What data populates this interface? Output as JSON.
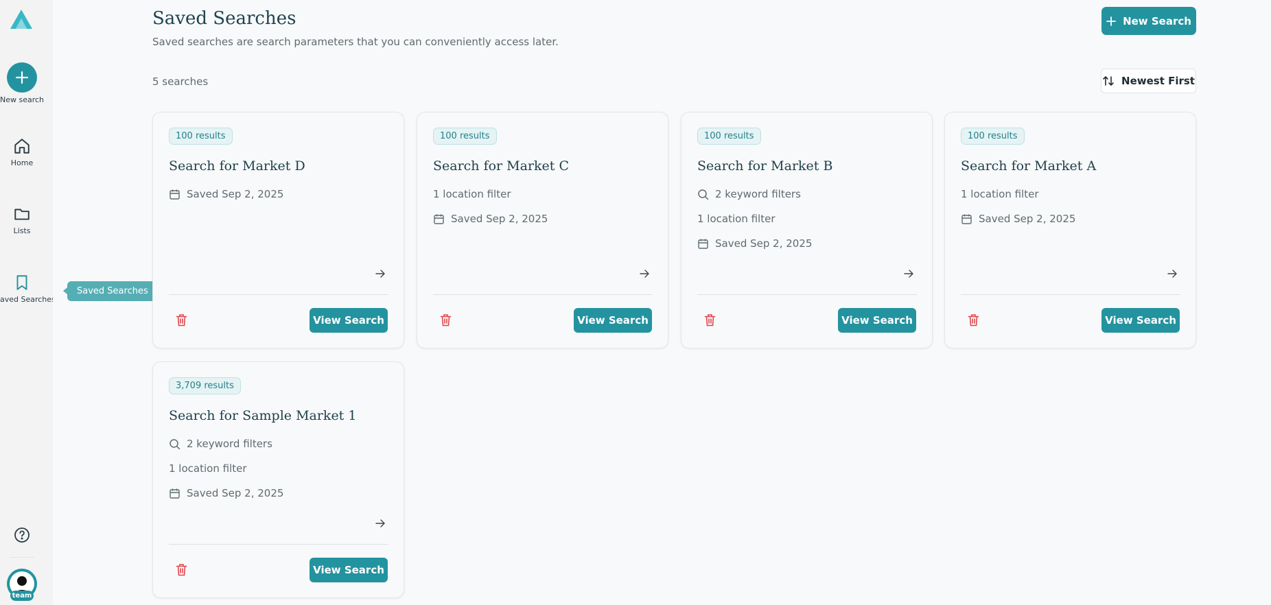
{
  "sidebar": {
    "new_search_label": "New search",
    "items": [
      {
        "label": "Home",
        "icon": "home-icon"
      },
      {
        "label": "Lists",
        "icon": "folder-icon"
      },
      {
        "label": "Saved Searches",
        "icon": "bookmark-icon"
      }
    ],
    "avatar_tag": "team",
    "tooltip": "Saved Searches"
  },
  "header": {
    "title": "Saved Searches",
    "subtitle": "Saved searches are search parameters that you can conveniently access later.",
    "new_search_button": "New Search",
    "count": "5 searches",
    "sort_label": "Newest First"
  },
  "cards": [
    {
      "badge": "100 results",
      "title": "Search for Market D",
      "saved": "Saved Sep 2, 2025",
      "view": "View Search"
    },
    {
      "badge": "100 results",
      "title": "Search for Market C",
      "location": "1 location filter",
      "saved": "Saved Sep 2, 2025",
      "view": "View Search"
    },
    {
      "badge": "100 results",
      "title": "Search for Market B",
      "keywords": "2 keyword filters",
      "location": "1 location filter",
      "saved": "Saved Sep 2, 2025",
      "view": "View Search"
    },
    {
      "badge": "100 results",
      "title": "Search for Market A",
      "location": "1 location filter",
      "saved": "Saved Sep 2, 2025",
      "view": "View Search"
    },
    {
      "badge": "3,709 results",
      "title": "Search for Sample Market 1",
      "keywords": "2 keyword filters",
      "location": "1 location filter",
      "saved": "Saved Sep 2, 2025",
      "view": "View Search"
    }
  ],
  "colors": {
    "accent": "#23939f",
    "delete": "#e0454a",
    "title": "#1d4450"
  }
}
